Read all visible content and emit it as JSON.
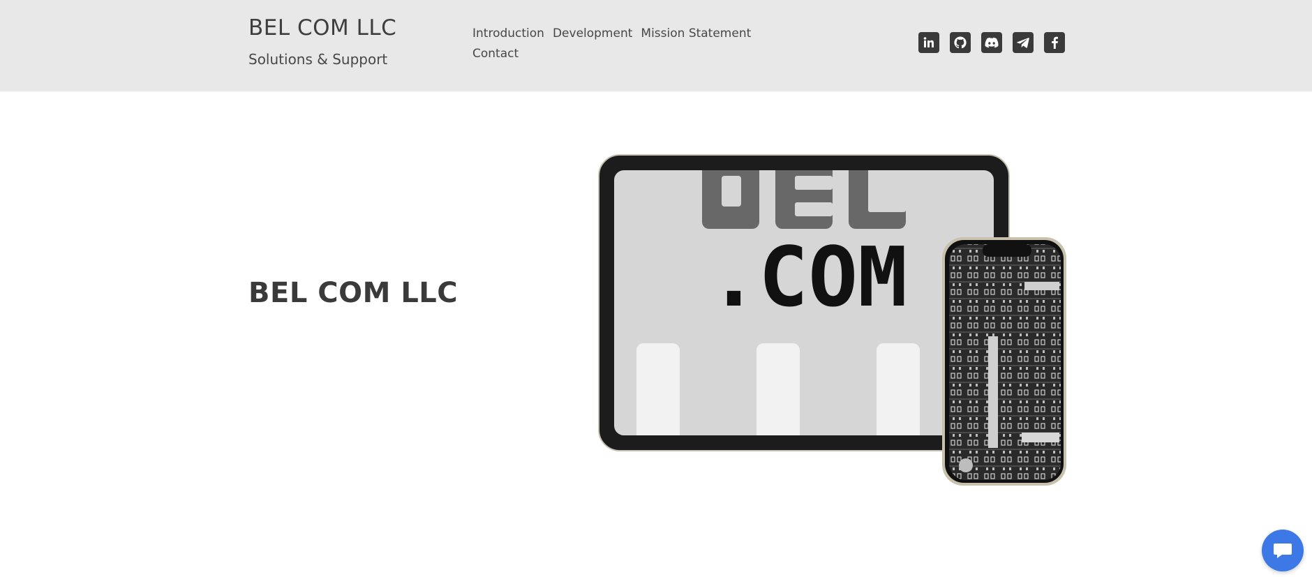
{
  "header": {
    "brand_title": "BEL COM LLC",
    "brand_tagline": "Solutions & Support",
    "background_color": "#e8e8e8",
    "nav_items": [
      {
        "label": "Introduction"
      },
      {
        "label": "Development"
      },
      {
        "label": "Mission Statement"
      },
      {
        "label": "Contact"
      }
    ],
    "social_icons": [
      {
        "icon": "linkedin-icon"
      },
      {
        "icon": "github-icon"
      },
      {
        "icon": "discord-icon"
      },
      {
        "icon": "telegram-icon"
      },
      {
        "icon": "facebook-icon"
      }
    ],
    "social_icon_color": "#3a3a3a"
  },
  "hero": {
    "title": "BEL COM LLC",
    "image_icon": "device-mockup-image",
    "tablet_screen_text": ".COM"
  },
  "chat_widget": {
    "icon": "chat-bubble-icon",
    "color": "#3c78e6"
  }
}
